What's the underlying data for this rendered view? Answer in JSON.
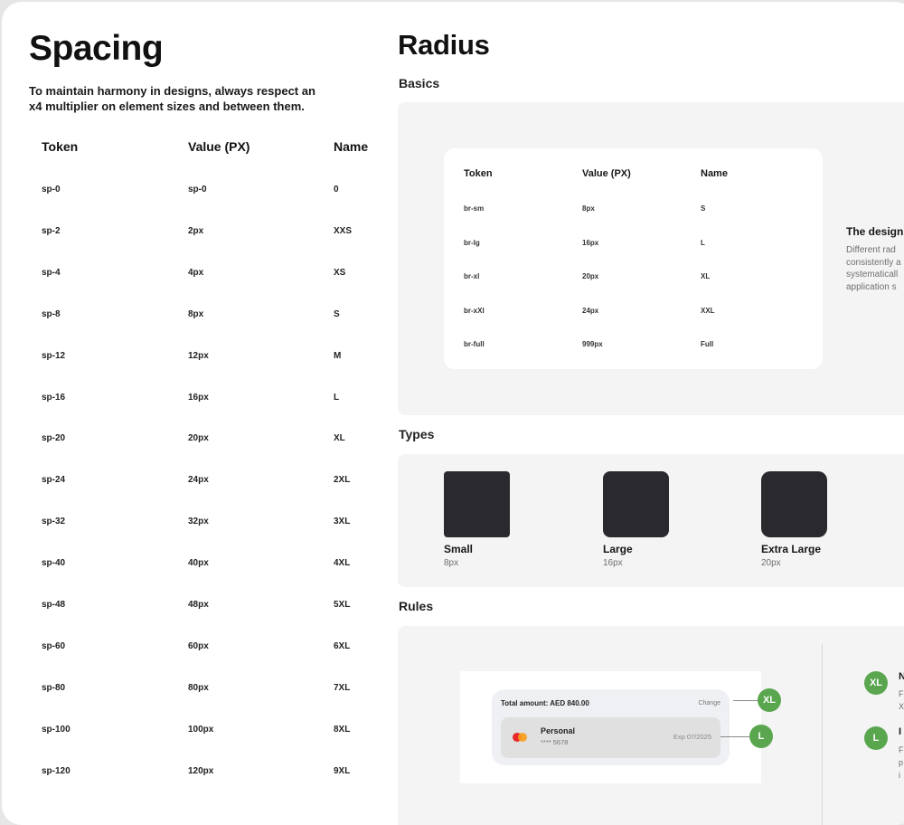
{
  "spacing": {
    "title": "Spacing",
    "description": "To maintain harmony in designs, always respect an x4 multiplier on element sizes and between them.",
    "headers": {
      "token": "Token",
      "value": "Value (PX)",
      "name": "Name"
    },
    "rows": [
      {
        "token": "sp-0",
        "value": "sp-0",
        "name": "0"
      },
      {
        "token": "sp-2",
        "value": "2px",
        "name": "XXS"
      },
      {
        "token": "sp-4",
        "value": "4px",
        "name": "XS"
      },
      {
        "token": "sp-8",
        "value": "8px",
        "name": "S"
      },
      {
        "token": "sp-12",
        "value": "12px",
        "name": "M"
      },
      {
        "token": "sp-16",
        "value": "16px",
        "name": "L"
      },
      {
        "token": "sp-20",
        "value": "20px",
        "name": "XL"
      },
      {
        "token": "sp-24",
        "value": "24px",
        "name": "2XL"
      },
      {
        "token": "sp-32",
        "value": "32px",
        "name": "3XL"
      },
      {
        "token": "sp-40",
        "value": "40px",
        "name": "4XL"
      },
      {
        "token": "sp-48",
        "value": "48px",
        "name": "5XL"
      },
      {
        "token": "sp-60",
        "value": "60px",
        "name": "6XL"
      },
      {
        "token": "sp-80",
        "value": "80px",
        "name": "7XL"
      },
      {
        "token": "sp-100",
        "value": "100px",
        "name": "8XL"
      },
      {
        "token": "sp-120",
        "value": "120px",
        "name": "9XL"
      }
    ]
  },
  "radius": {
    "title": "Radius",
    "basics": {
      "heading": "Basics",
      "headers": {
        "token": "Token",
        "value": "Value (PX)",
        "name": "Name"
      },
      "rows": [
        {
          "token": "br-sm",
          "value": "8px",
          "name": "S"
        },
        {
          "token": "br-lg",
          "value": "16px",
          "name": "L"
        },
        {
          "token": "br-xl",
          "value": "20px",
          "name": "XL"
        },
        {
          "token": "br-xXl",
          "value": "24px",
          "name": "XXL"
        },
        {
          "token": "br-full",
          "value": "999px",
          "name": "Full"
        }
      ],
      "side_title": "The design",
      "side_text_lines": [
        "Different rad",
        "consistently a",
        "systematicall",
        "application s"
      ]
    },
    "types": {
      "heading": "Types",
      "items": [
        {
          "name": "Small",
          "value": "8px",
          "radius": 8
        },
        {
          "name": "Large",
          "value": "16px",
          "radius": 16
        },
        {
          "name": "Extra Large",
          "value": "20px",
          "radius": 20
        }
      ]
    },
    "rules": {
      "heading": "Rules",
      "example": {
        "total": "Total amount: AED 840.00",
        "change": "Change",
        "method_name": "Personal",
        "method_number": "**** 5678",
        "expiry": "Exp 07/2025"
      },
      "badges": [
        "XL",
        "L"
      ],
      "side": [
        {
          "badge": "XL",
          "title": "N",
          "text_lines": [
            "F",
            "X"
          ]
        },
        {
          "badge": "L",
          "title": "I",
          "text_lines": [
            "F",
            "p",
            "i"
          ]
        }
      ]
    }
  },
  "colors": {
    "badge_green": "#5aa64f",
    "type_box": "#2a2a2e",
    "panel_bg": "#f4f4f4"
  }
}
